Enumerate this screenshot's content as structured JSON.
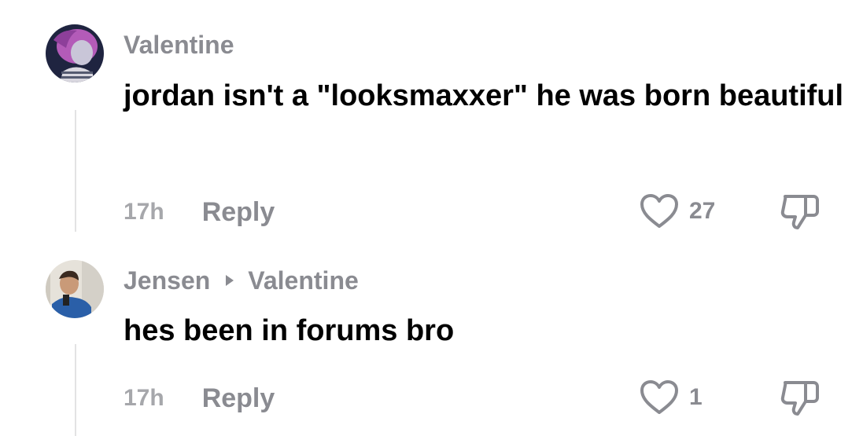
{
  "comments": [
    {
      "username": "Valentine",
      "reply_to": "",
      "text": "jordan isn't a \"looksmaxxer\" he was born beautiful",
      "time": "17h",
      "reply_label": "Reply",
      "likes": "27"
    },
    {
      "username": "Jensen",
      "reply_to": "Valentine",
      "text": "hes been in forums bro",
      "time": "17h",
      "reply_label": "Reply",
      "likes": "1"
    }
  ],
  "colors": {
    "username": "#8a8b91",
    "timestamp": "#a6a7ab",
    "text": "#000000",
    "thread_line": "#e3e3e4"
  },
  "icons": {
    "like": "heart-outline-icon",
    "dislike": "thumbs-down-outline-icon",
    "reply_to": "triangle-right-icon"
  }
}
